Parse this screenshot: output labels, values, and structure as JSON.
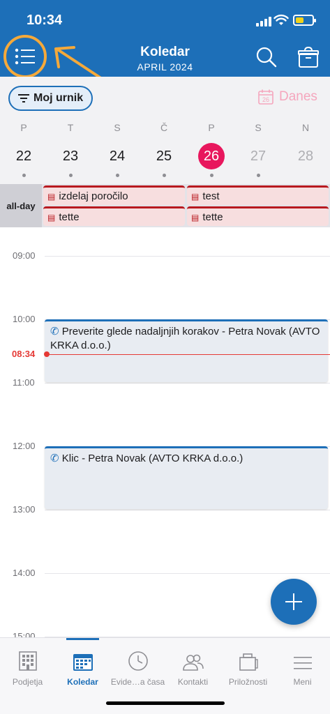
{
  "status": {
    "time": "10:34"
  },
  "header": {
    "title": "Koledar",
    "subtitle": "APRIL 2024"
  },
  "filter": {
    "pill_label": "Moj urnik",
    "today_label": "Danes",
    "today_icon_number": "26"
  },
  "week": {
    "days": [
      {
        "weekday": "P",
        "date": "22"
      },
      {
        "weekday": "T",
        "date": "23"
      },
      {
        "weekday": "S",
        "date": "24"
      },
      {
        "weekday": "Č",
        "date": "25"
      },
      {
        "weekday": "P",
        "date": "26"
      },
      {
        "weekday": "S",
        "date": "27"
      },
      {
        "weekday": "N",
        "date": "28"
      }
    ]
  },
  "allday": {
    "label": "all-day",
    "items": [
      "izdelaj poročilo",
      "test",
      "tette",
      "tette"
    ]
  },
  "timeline": {
    "hours": [
      "09:00",
      "10:00",
      "11:00",
      "12:00",
      "13:00",
      "14:00",
      "15:00"
    ],
    "now_label": "08:34",
    "events": [
      {
        "title": "Preverite glede nadaljnjih korakov - Petra Novak (AVTO KRKA d.o.o.)"
      },
      {
        "title": "Klic - Petra Novak (AVTO KRKA d.o.o.)"
      }
    ]
  },
  "tabs": [
    {
      "label": "Podjetja"
    },
    {
      "label": "Koledar"
    },
    {
      "label": "Evide…a časa"
    },
    {
      "label": "Kontakti"
    },
    {
      "label": "Priložnosti"
    },
    {
      "label": "Meni"
    }
  ],
  "colors": {
    "primary": "#1d6fb8",
    "accent_highlight": "#f5a93a",
    "selected_day": "#e8175d",
    "now": "#e53935",
    "allday_event": "#b8191f"
  }
}
